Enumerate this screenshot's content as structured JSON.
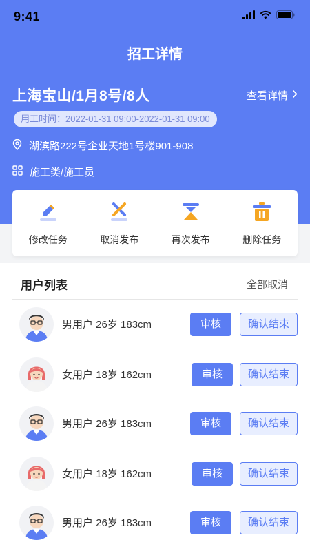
{
  "status_bar": {
    "time": "9:41"
  },
  "nav": {
    "title": "招工详情"
  },
  "job": {
    "title": "上海宝山/1月8号/8人",
    "view_detail": "查看详情",
    "work_time": "用工时间：2022-01-31 09:00-2022-01-31 09:00",
    "address": "湖滨路222号企业天地1号楼901-908",
    "category": "施工类/施工员"
  },
  "actions": [
    {
      "label": "修改任务",
      "icon": "edit-icon"
    },
    {
      "label": "取消发布",
      "icon": "cancel-icon"
    },
    {
      "label": "再次发布",
      "icon": "hourglass-icon"
    },
    {
      "label": "删除任务",
      "icon": "trash-icon"
    }
  ],
  "user_list": {
    "title": "用户列表",
    "cancel_all": "全部取消",
    "review_label": "审核",
    "confirm_label": "确认结束",
    "users": [
      {
        "info": "男用户 26岁 183cm",
        "gender": "male"
      },
      {
        "info": "女用户 18岁 162cm",
        "gender": "female"
      },
      {
        "info": "男用户 26岁 183cm",
        "gender": "male"
      },
      {
        "info": "女用户 18岁 162cm",
        "gender": "female"
      },
      {
        "info": "男用户 26岁 183cm",
        "gender": "male"
      }
    ]
  },
  "colors": {
    "primary": "#5b7df3",
    "accent_orange": "#f5a623",
    "light_blue": "#e8eeff"
  }
}
